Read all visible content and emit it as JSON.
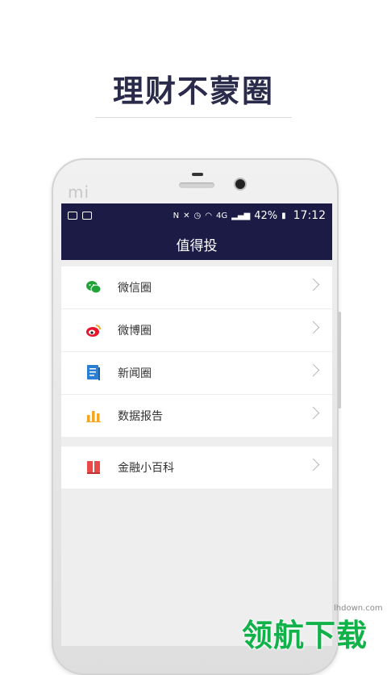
{
  "promo": {
    "headline": "理财不蒙圈"
  },
  "device": {
    "logo": "mi"
  },
  "status_bar": {
    "battery": "42%",
    "time": "17:12",
    "network": "4G"
  },
  "app": {
    "title": "值得投"
  },
  "menu": [
    {
      "label": "微信圈",
      "icon": "wechat-icon",
      "color": "#22a33a"
    },
    {
      "label": "微博圈",
      "icon": "weibo-icon",
      "color": "#e6162d"
    },
    {
      "label": "新闻圈",
      "icon": "news-icon",
      "color": "#2a7fd4"
    },
    {
      "label": "数据报告",
      "icon": "bar-chart-icon",
      "color": "#f5a623"
    }
  ],
  "menu2": [
    {
      "label": "金融小百科",
      "icon": "book-icon",
      "color": "#e84a4a"
    }
  ],
  "watermark": {
    "brand": "领航下载",
    "url": "lhdown.com"
  }
}
